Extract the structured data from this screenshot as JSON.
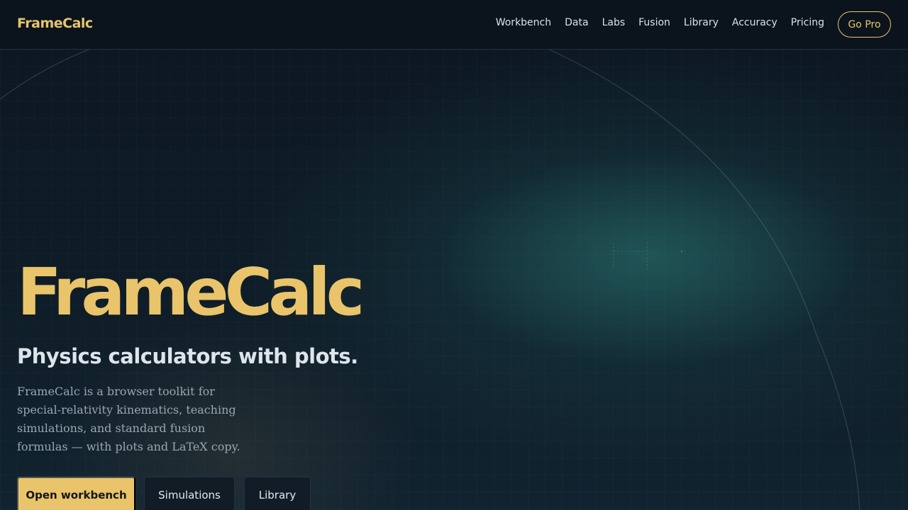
{
  "brand": {
    "name": "FrameCalc"
  },
  "nav": {
    "links": [
      "Workbench",
      "Data",
      "Labs",
      "Fusion",
      "Library",
      "Accuracy",
      "Pricing"
    ],
    "cta_label": "Go Pro"
  },
  "hero": {
    "title": "FrameCalc",
    "subtitle": "Physics calculators with plots.",
    "description": "FrameCalc is a browser toolkit for special-relativity kinematics, teaching simulations, and standard fusion formulas — with plots and LaTeX copy.",
    "buttons": {
      "primary": "Open workbench",
      "simulations": "Simulations",
      "library": "Library"
    }
  },
  "colors": {
    "accent": "#e9c46a",
    "background": "#0d1823",
    "nav_background": "#0b141d"
  }
}
